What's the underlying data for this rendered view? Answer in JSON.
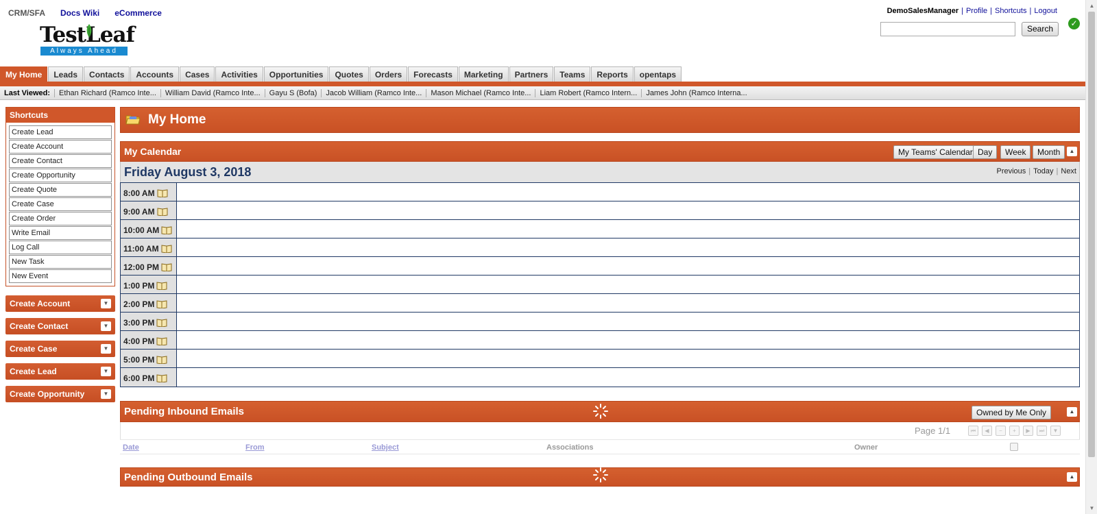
{
  "app_links": [
    "CRM/SFA",
    "Docs Wiki",
    "eCommerce"
  ],
  "logo": {
    "text": "TestLeaf",
    "tagline": "Always Ahead"
  },
  "user": {
    "name": "DemoSalesManager",
    "links": [
      "Profile",
      "Shortcuts",
      "Logout"
    ]
  },
  "search": {
    "button": "Search",
    "placeholder": ""
  },
  "tabs": [
    "My Home",
    "Leads",
    "Contacts",
    "Accounts",
    "Cases",
    "Activities",
    "Opportunities",
    "Quotes",
    "Orders",
    "Forecasts",
    "Marketing",
    "Partners",
    "Teams",
    "Reports",
    "opentaps"
  ],
  "active_tab": "My Home",
  "last_viewed": {
    "label": "Last Viewed:",
    "items": [
      "Ethan Richard (Ramco Inte...",
      "William David (Ramco Inte...",
      "Gayu S (Bofa)",
      "Jacob William (Ramco Inte...",
      "Mason Michael (Ramco Inte...",
      "Liam Robert (Ramco Intern...",
      "James John (Ramco Interna..."
    ]
  },
  "shortcuts": {
    "title": "Shortcuts",
    "items": [
      "Create Lead",
      "Create Account",
      "Create Contact",
      "Create Opportunity",
      "Create Quote",
      "Create Case",
      "Create Order",
      "Write Email",
      "Log Call",
      "New Task",
      "New Event"
    ]
  },
  "side_panels": [
    "Create Account",
    "Create Contact",
    "Create Case",
    "Create Lead",
    "Create Opportunity"
  ],
  "home": {
    "title": "My Home"
  },
  "calendar": {
    "title": "My Calendar",
    "buttons": {
      "teams": "My Teams' Calendar",
      "day": "Day",
      "week": "Week",
      "month": "Month"
    },
    "date": "Friday August 3, 2018",
    "nav": {
      "previous": "Previous",
      "today": "Today",
      "next": "Next"
    },
    "slots": [
      "8:00 AM",
      "9:00 AM",
      "10:00 AM",
      "11:00 AM",
      "12:00 PM",
      "1:00 PM",
      "2:00 PM",
      "3:00 PM",
      "4:00 PM",
      "5:00 PM",
      "6:00 PM"
    ]
  },
  "inbound": {
    "title": "Pending Inbound Emails",
    "filter_button": "Owned by Me Only",
    "page": "Page 1/1",
    "columns": {
      "date": "Date",
      "from": "From",
      "subject": "Subject",
      "associations": "Associations",
      "owner": "Owner"
    }
  },
  "outbound": {
    "title": "Pending Outbound Emails"
  },
  "colors": {
    "accent": "#d0572a",
    "link": "#10109a",
    "calendar_border": "#1f3864"
  }
}
